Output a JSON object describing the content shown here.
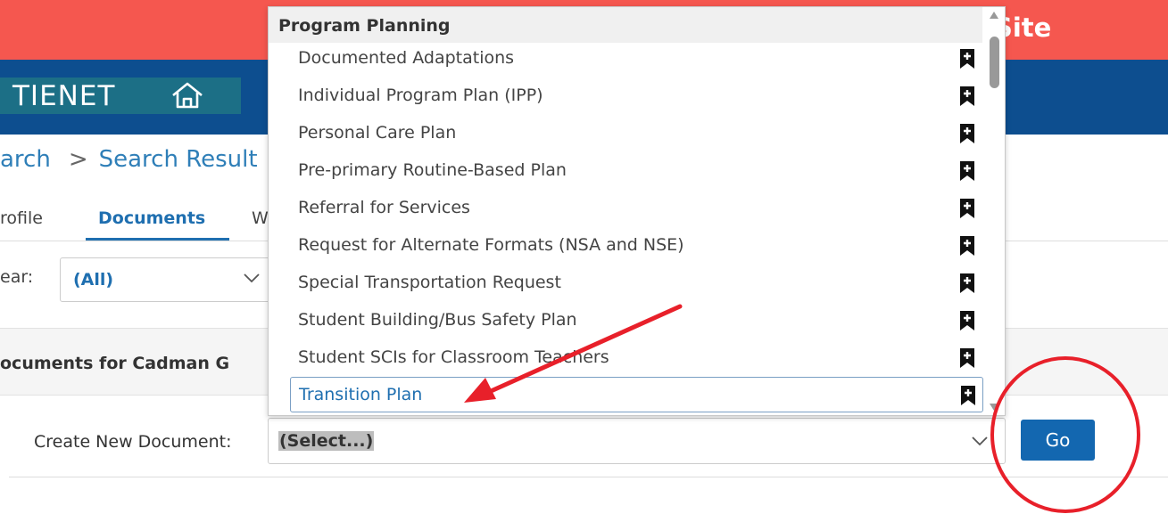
{
  "banner": {
    "title_fragment": "t Site"
  },
  "brand": {
    "logo_text": "TIENET"
  },
  "breadcrumb": {
    "items": [
      "arch",
      "Search Result"
    ],
    "separator": ">"
  },
  "tabs": {
    "profile": "rofile",
    "documents": "Documents",
    "w": "W"
  },
  "year_filter": {
    "label": "ear:",
    "value": "(All)"
  },
  "documents_panel": {
    "title": "ocuments for Cadman G"
  },
  "create_document": {
    "label": "Create New Document:",
    "value": "(Select...)",
    "go_label": "Go"
  },
  "dropdown": {
    "group_label": "Program Planning",
    "options": [
      {
        "label": "Documented Adaptations",
        "icon": "bookmark-add-icon"
      },
      {
        "label": "Individual Program Plan (IPP)",
        "icon": "bookmark-add-icon"
      },
      {
        "label": "Personal Care Plan",
        "icon": "bookmark-add-icon"
      },
      {
        "label": "Pre-primary Routine-Based Plan",
        "icon": "bookmark-add-icon"
      },
      {
        "label": "Referral for Services",
        "icon": "bookmark-add-icon"
      },
      {
        "label": "Request for Alternate Formats (NSA and NSE)",
        "icon": "bookmark-add-icon"
      },
      {
        "label": "Special Transportation Request",
        "icon": "bookmark-add-icon"
      },
      {
        "label": "Student Building/Bus Safety Plan",
        "icon": "bookmark-add-icon"
      },
      {
        "label": "Student SCIs for Classroom Teachers",
        "icon": "bookmark-add-icon"
      },
      {
        "label": "Transition Plan",
        "icon": "bookmark-add-icon",
        "selected": true
      }
    ]
  },
  "colors": {
    "banner": "#f5574f",
    "nav": "#0d4e8f",
    "logo_box": "#1c6f86",
    "link_blue": "#1f6fb0",
    "go_button": "#1367b0",
    "annotation_red": "#e8202a"
  },
  "icons": {
    "home": "home-icon",
    "chevron": "chevron-down-icon",
    "bookmark": "bookmark-add-icon"
  }
}
